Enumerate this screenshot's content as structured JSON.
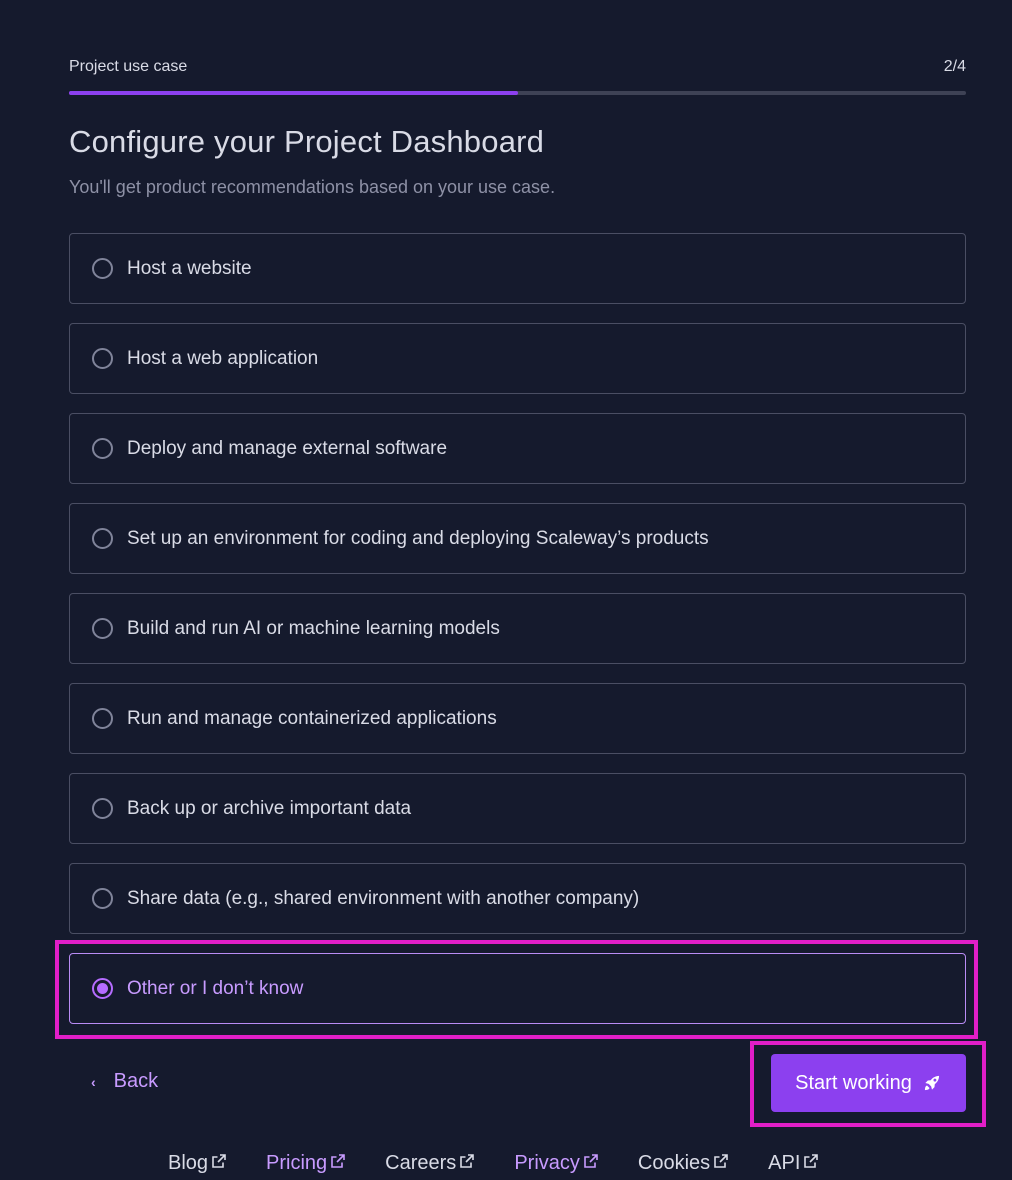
{
  "progress": {
    "step_label": "Project use case",
    "step_count": "2/4",
    "fraction": 0.5
  },
  "title": "Configure your Project Dashboard",
  "subtitle": "You'll get product recommendations based on your use case.",
  "options": [
    {
      "label": "Host a website",
      "selected": false
    },
    {
      "label": "Host a web application",
      "selected": false
    },
    {
      "label": "Deploy and manage external software",
      "selected": false
    },
    {
      "label": "Set up an environment for coding and deploying Scaleway’s products",
      "selected": false
    },
    {
      "label": "Build and run AI or machine learning models",
      "selected": false
    },
    {
      "label": "Run and manage containerized applications",
      "selected": false
    },
    {
      "label": "Back up or archive important data",
      "selected": false
    },
    {
      "label": "Share data (e.g., shared environment with another company)",
      "selected": false
    },
    {
      "label": "Other or I don’t know",
      "selected": true
    }
  ],
  "actions": {
    "back_label": "Back",
    "start_label": "Start working",
    "start_icon": "rocket-icon"
  },
  "footer": {
    "links": [
      {
        "label": "Blog",
        "icon": "external-link-icon"
      },
      {
        "label": "Pricing",
        "icon": "external-link-icon"
      },
      {
        "label": "Careers",
        "icon": "external-link-icon"
      },
      {
        "label": "Privacy",
        "icon": "external-link-icon"
      },
      {
        "label": "Cookies",
        "icon": "external-link-icon"
      },
      {
        "label": "API",
        "icon": "external-link-icon"
      }
    ]
  },
  "colors": {
    "background": "#151a2d",
    "accent": "#8c40ef",
    "accent_text": "#c89bff",
    "highlight": "#e11ec7"
  }
}
